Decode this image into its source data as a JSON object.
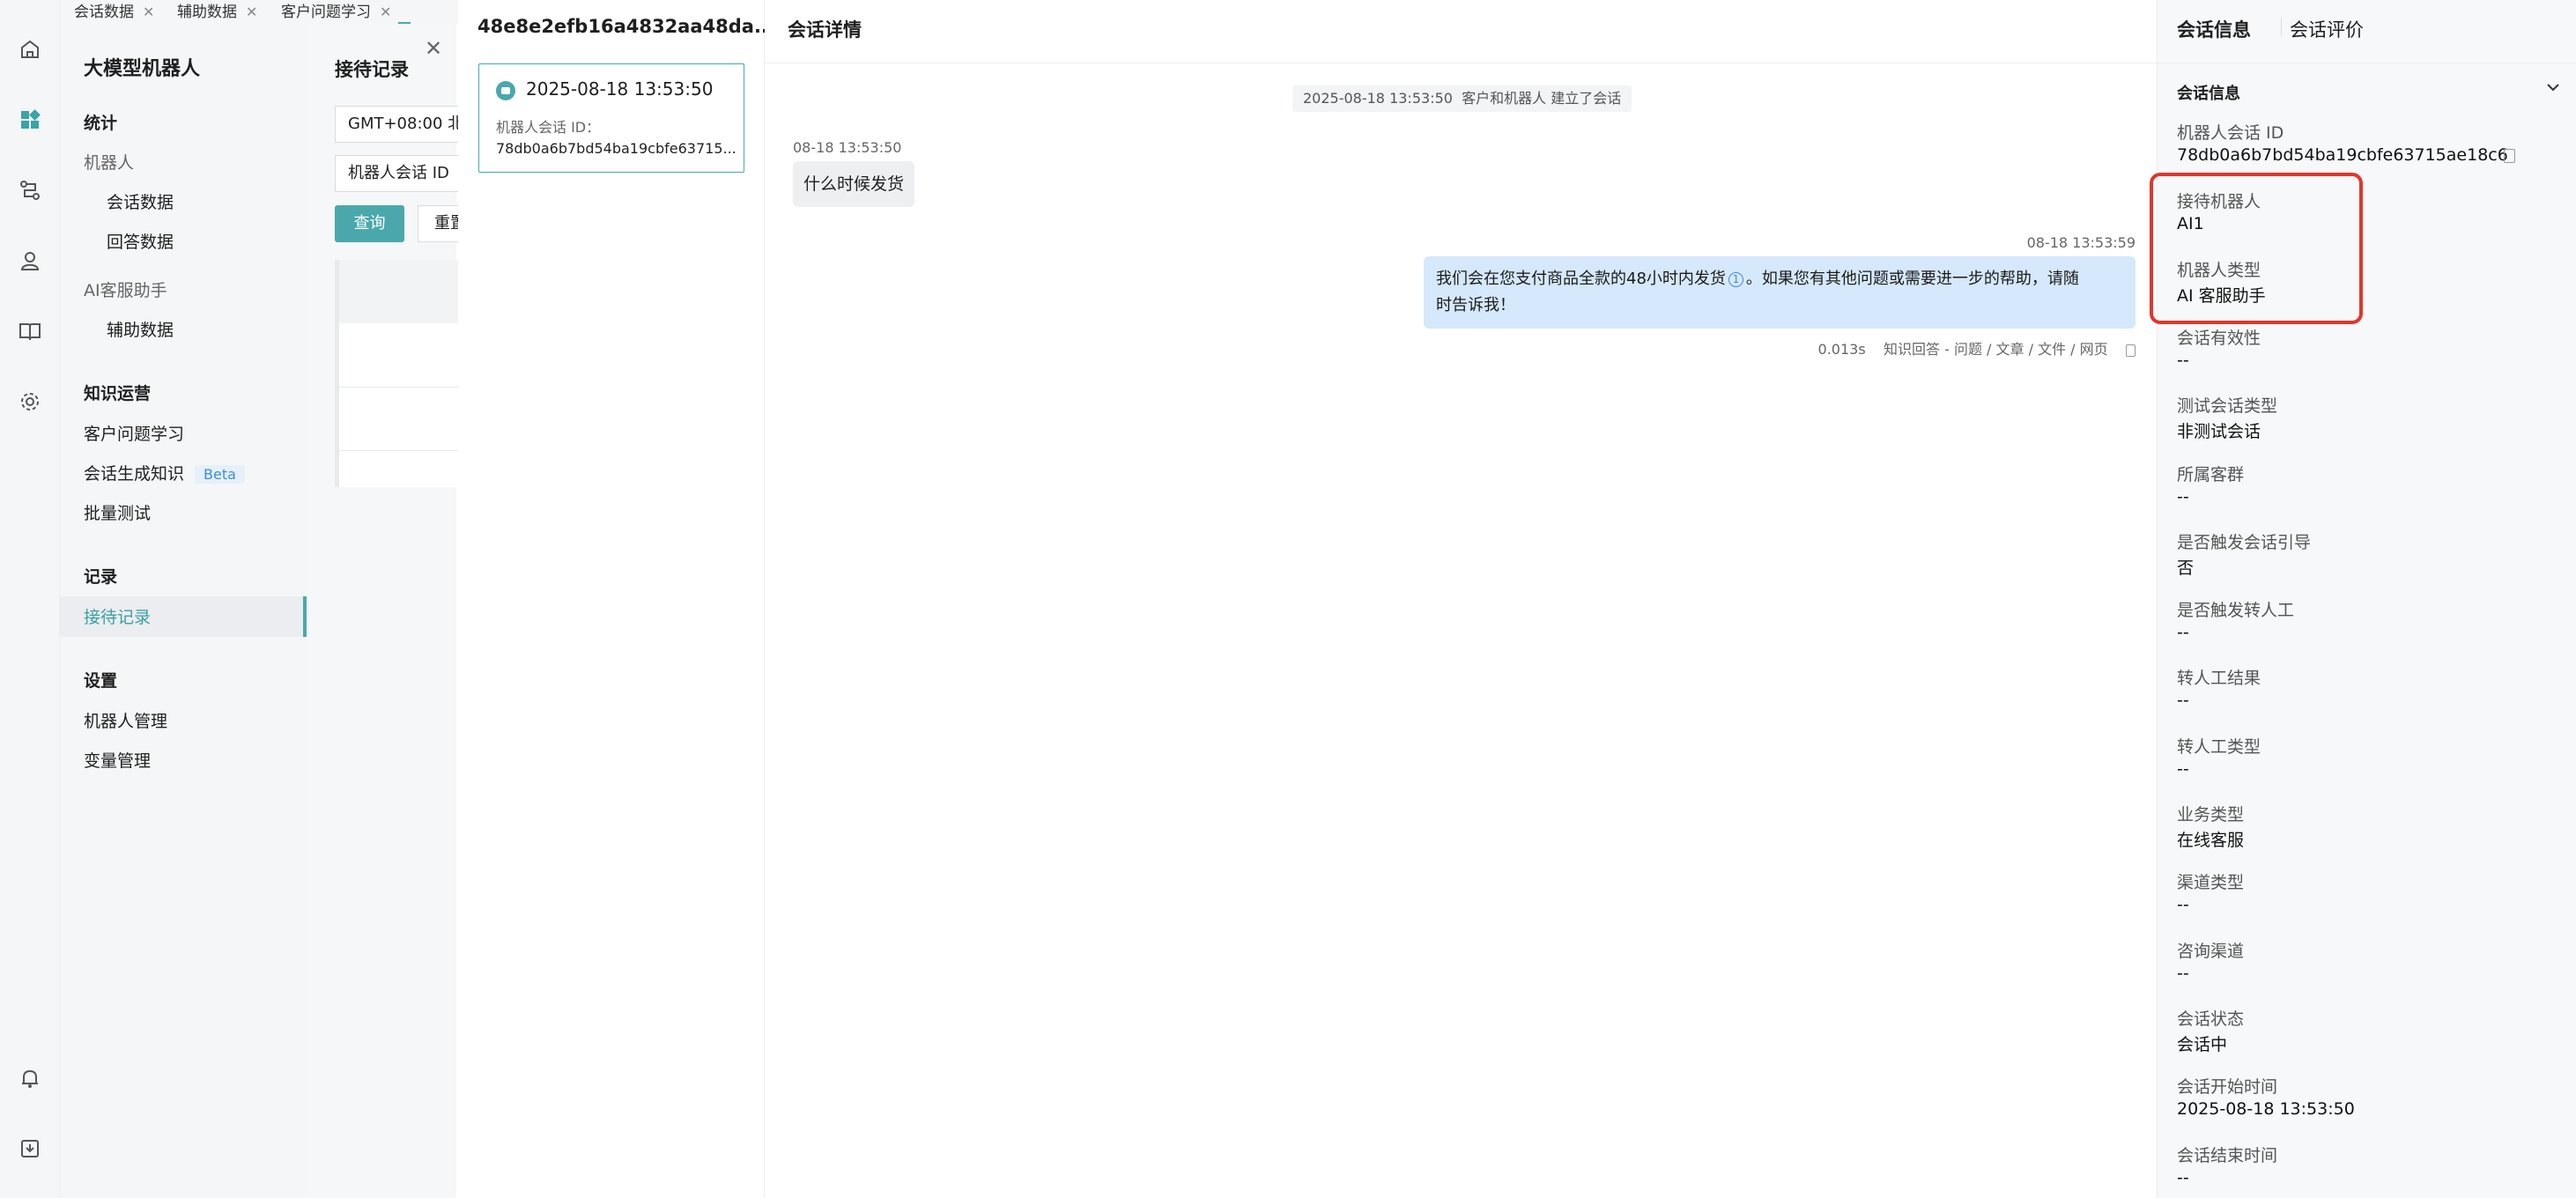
{
  "tabs": [
    {
      "label": "会话数据"
    },
    {
      "label": "辅助数据"
    },
    {
      "label": "客户问题学习"
    }
  ],
  "nav": {
    "title": "大模型机器人",
    "stats_head": "统计",
    "robot_group": "机器人",
    "conv_data": "会话数据",
    "answer_data": "回答数据",
    "ai_group": "AI客服助手",
    "aux_data": "辅助数据",
    "knowledge_head": "知识运营",
    "customer_learning": "客户问题学习",
    "conv_knowledge": "会话生成知识",
    "beta": "Beta",
    "batch_test": "批量测试",
    "record_head": "记录",
    "reception_record": "接待记录",
    "settings_head": "设置",
    "robot_manage": "机器人管理",
    "var_manage": "变量管理"
  },
  "records_page": {
    "title": "接待记录",
    "timezone": "GMT+08:00 北",
    "session_select": "机器人会话 ID",
    "query_btn": "查询",
    "reset_btn": "重置"
  },
  "conv_list": {
    "header": "48e8e2efb16a4832aa48da...",
    "card": {
      "time": "2025-08-18 13:53:50",
      "id_label": "机器人会话 ID：",
      "id_value": "78db0a6b7bd54ba19cbfe63715..."
    }
  },
  "detail": {
    "title": "会话详情",
    "system_time": "2025-08-18 13:53:50",
    "system_text": "客户和机器人 建立了会话",
    "user_time": "08-18 13:53:50",
    "user_msg": "什么时候发货",
    "bot_time": "08-18 13:53:59",
    "bot_msg_1": "我们会在您支付商品全款的48小时内发货",
    "bot_msg_2": "。如果您有其他问题或需要进一步的帮助，请随",
    "bot_msg_3": "时告诉我！",
    "bot_latency": "0.013s",
    "bot_source": "知识回答 - 问题 / 文章 / 文件 / 网页"
  },
  "info": {
    "tab_info": "会话信息",
    "tab_eval": "会话评价",
    "section_title": "会话信息",
    "session_id_label": "机器人会话 ID",
    "session_id_value": "78db0a6b7bd54ba19cbfe63715ae18c6",
    "fields": [
      {
        "label": "接待机器人",
        "value": "AI1"
      },
      {
        "label": "机器人类型",
        "value": "AI 客服助手"
      },
      {
        "label": "会话有效性",
        "value": "--"
      },
      {
        "label": "测试会话类型",
        "value": "非测试会话"
      },
      {
        "label": "所属客群",
        "value": "--"
      },
      {
        "label": "是否触发会话引导",
        "value": "否"
      },
      {
        "label": "是否触发转人工",
        "value": "--"
      },
      {
        "label": "转人工结果",
        "value": "--"
      },
      {
        "label": "转人工类型",
        "value": "--"
      },
      {
        "label": "业务类型",
        "value": "在线客服"
      },
      {
        "label": "渠道类型",
        "value": "--"
      },
      {
        "label": "咨询渠道",
        "value": "--"
      },
      {
        "label": "会话状态",
        "value": "会话中"
      },
      {
        "label": "会话开始时间",
        "value": "2025-08-18 13:53:50"
      },
      {
        "label": "会话结束时间",
        "value": "--"
      }
    ]
  },
  "colors": {
    "accent": "#4aa8ac",
    "bot_bubble": "#d6e8fb",
    "highlight_box": "#e0362c"
  }
}
